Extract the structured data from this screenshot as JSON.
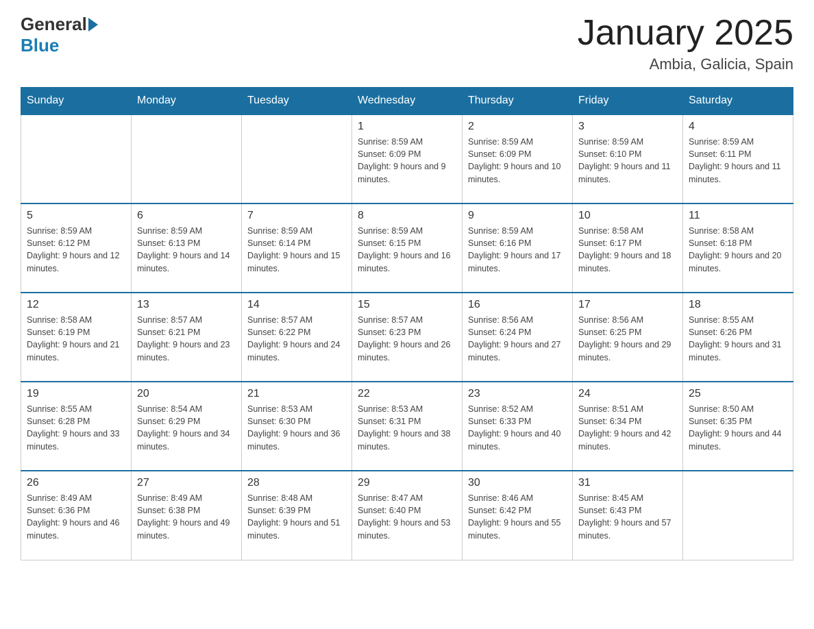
{
  "header": {
    "logo": {
      "text_general": "General",
      "text_blue": "Blue"
    },
    "title": "January 2025",
    "location": "Ambia, Galicia, Spain"
  },
  "calendar": {
    "days_of_week": [
      "Sunday",
      "Monday",
      "Tuesday",
      "Wednesday",
      "Thursday",
      "Friday",
      "Saturday"
    ],
    "weeks": [
      [
        {
          "day": "",
          "info": ""
        },
        {
          "day": "",
          "info": ""
        },
        {
          "day": "",
          "info": ""
        },
        {
          "day": "1",
          "info": "Sunrise: 8:59 AM\nSunset: 6:09 PM\nDaylight: 9 hours and 9 minutes."
        },
        {
          "day": "2",
          "info": "Sunrise: 8:59 AM\nSunset: 6:09 PM\nDaylight: 9 hours and 10 minutes."
        },
        {
          "day": "3",
          "info": "Sunrise: 8:59 AM\nSunset: 6:10 PM\nDaylight: 9 hours and 11 minutes."
        },
        {
          "day": "4",
          "info": "Sunrise: 8:59 AM\nSunset: 6:11 PM\nDaylight: 9 hours and 11 minutes."
        }
      ],
      [
        {
          "day": "5",
          "info": "Sunrise: 8:59 AM\nSunset: 6:12 PM\nDaylight: 9 hours and 12 minutes."
        },
        {
          "day": "6",
          "info": "Sunrise: 8:59 AM\nSunset: 6:13 PM\nDaylight: 9 hours and 14 minutes."
        },
        {
          "day": "7",
          "info": "Sunrise: 8:59 AM\nSunset: 6:14 PM\nDaylight: 9 hours and 15 minutes."
        },
        {
          "day": "8",
          "info": "Sunrise: 8:59 AM\nSunset: 6:15 PM\nDaylight: 9 hours and 16 minutes."
        },
        {
          "day": "9",
          "info": "Sunrise: 8:59 AM\nSunset: 6:16 PM\nDaylight: 9 hours and 17 minutes."
        },
        {
          "day": "10",
          "info": "Sunrise: 8:58 AM\nSunset: 6:17 PM\nDaylight: 9 hours and 18 minutes."
        },
        {
          "day": "11",
          "info": "Sunrise: 8:58 AM\nSunset: 6:18 PM\nDaylight: 9 hours and 20 minutes."
        }
      ],
      [
        {
          "day": "12",
          "info": "Sunrise: 8:58 AM\nSunset: 6:19 PM\nDaylight: 9 hours and 21 minutes."
        },
        {
          "day": "13",
          "info": "Sunrise: 8:57 AM\nSunset: 6:21 PM\nDaylight: 9 hours and 23 minutes."
        },
        {
          "day": "14",
          "info": "Sunrise: 8:57 AM\nSunset: 6:22 PM\nDaylight: 9 hours and 24 minutes."
        },
        {
          "day": "15",
          "info": "Sunrise: 8:57 AM\nSunset: 6:23 PM\nDaylight: 9 hours and 26 minutes."
        },
        {
          "day": "16",
          "info": "Sunrise: 8:56 AM\nSunset: 6:24 PM\nDaylight: 9 hours and 27 minutes."
        },
        {
          "day": "17",
          "info": "Sunrise: 8:56 AM\nSunset: 6:25 PM\nDaylight: 9 hours and 29 minutes."
        },
        {
          "day": "18",
          "info": "Sunrise: 8:55 AM\nSunset: 6:26 PM\nDaylight: 9 hours and 31 minutes."
        }
      ],
      [
        {
          "day": "19",
          "info": "Sunrise: 8:55 AM\nSunset: 6:28 PM\nDaylight: 9 hours and 33 minutes."
        },
        {
          "day": "20",
          "info": "Sunrise: 8:54 AM\nSunset: 6:29 PM\nDaylight: 9 hours and 34 minutes."
        },
        {
          "day": "21",
          "info": "Sunrise: 8:53 AM\nSunset: 6:30 PM\nDaylight: 9 hours and 36 minutes."
        },
        {
          "day": "22",
          "info": "Sunrise: 8:53 AM\nSunset: 6:31 PM\nDaylight: 9 hours and 38 minutes."
        },
        {
          "day": "23",
          "info": "Sunrise: 8:52 AM\nSunset: 6:33 PM\nDaylight: 9 hours and 40 minutes."
        },
        {
          "day": "24",
          "info": "Sunrise: 8:51 AM\nSunset: 6:34 PM\nDaylight: 9 hours and 42 minutes."
        },
        {
          "day": "25",
          "info": "Sunrise: 8:50 AM\nSunset: 6:35 PM\nDaylight: 9 hours and 44 minutes."
        }
      ],
      [
        {
          "day": "26",
          "info": "Sunrise: 8:49 AM\nSunset: 6:36 PM\nDaylight: 9 hours and 46 minutes."
        },
        {
          "day": "27",
          "info": "Sunrise: 8:49 AM\nSunset: 6:38 PM\nDaylight: 9 hours and 49 minutes."
        },
        {
          "day": "28",
          "info": "Sunrise: 8:48 AM\nSunset: 6:39 PM\nDaylight: 9 hours and 51 minutes."
        },
        {
          "day": "29",
          "info": "Sunrise: 8:47 AM\nSunset: 6:40 PM\nDaylight: 9 hours and 53 minutes."
        },
        {
          "day": "30",
          "info": "Sunrise: 8:46 AM\nSunset: 6:42 PM\nDaylight: 9 hours and 55 minutes."
        },
        {
          "day": "31",
          "info": "Sunrise: 8:45 AM\nSunset: 6:43 PM\nDaylight: 9 hours and 57 minutes."
        },
        {
          "day": "",
          "info": ""
        }
      ]
    ]
  }
}
